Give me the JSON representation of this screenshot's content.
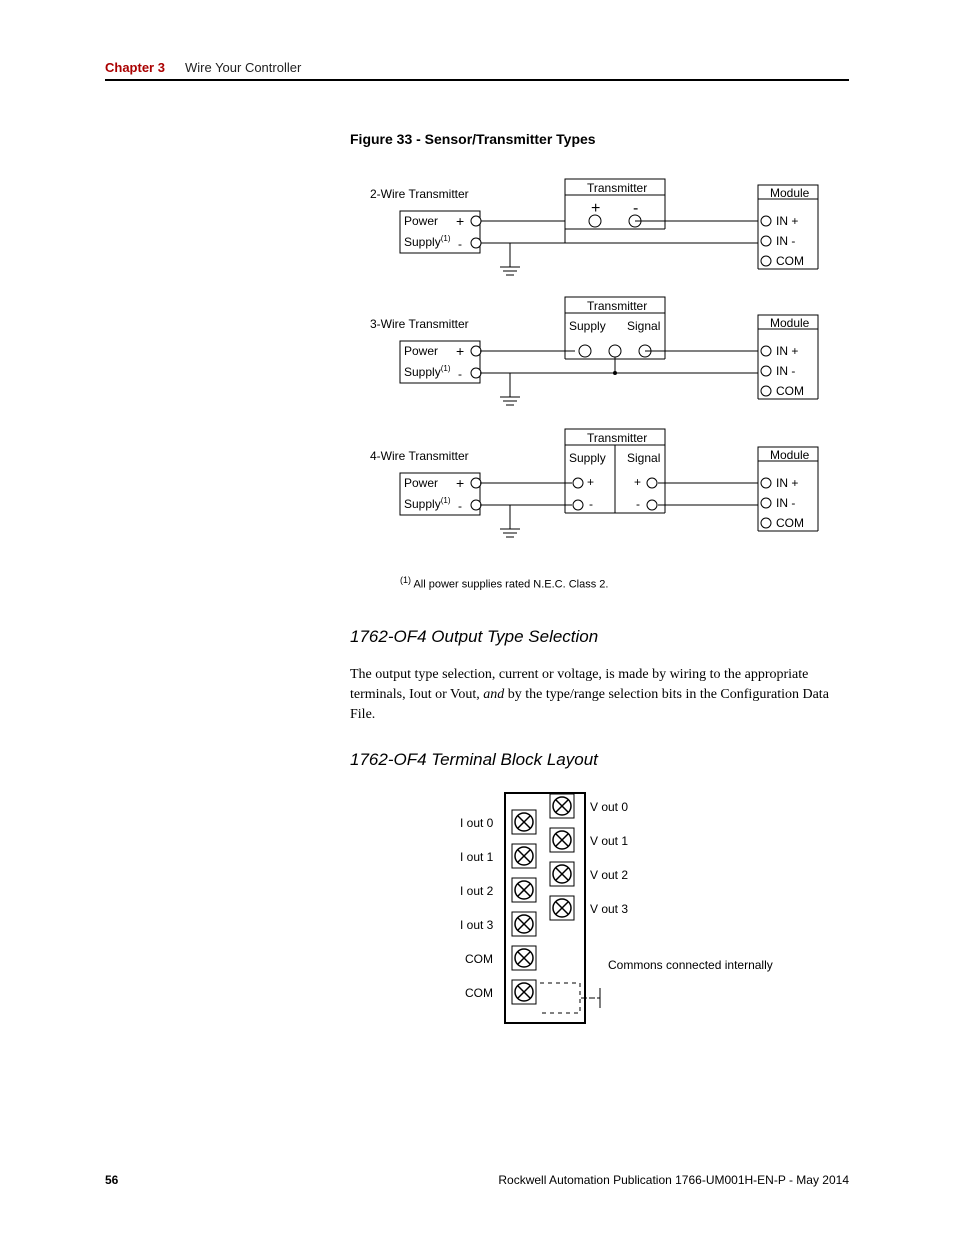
{
  "header": {
    "chapter_label": "Chapter 3",
    "chapter_title": "Wire Your Controller"
  },
  "figure33": {
    "caption": "Figure 33 - Sensor/Transmitter Types",
    "transmitters": {
      "two_wire": {
        "title": "2-Wire Transmitter",
        "tx_label": "Transmitter",
        "tx_plus": "+",
        "tx_minus": "-"
      },
      "three_wire": {
        "title": "3-Wire Transmitter",
        "tx_label": "Transmitter",
        "supply": "Supply",
        "signal": "Signal"
      },
      "four_wire": {
        "title": "4-Wire Transmitter",
        "tx_label": "Transmitter",
        "supply": "Supply",
        "signal": "Signal",
        "plus": "+",
        "minus": "-"
      }
    },
    "power": {
      "label1": "Power",
      "label2": "Supply",
      "super": "(1)",
      "plus": "+",
      "minus": "-"
    },
    "module": {
      "title": "Module",
      "in_plus": "IN +",
      "in_minus": "IN -",
      "com": "COM"
    },
    "footnote_super": "(1)",
    "footnote": " All power supplies rated N.E.C. Class 2."
  },
  "section_output": {
    "title": "1762-OF4 Output Type Selection",
    "body_a": "The output type selection, current or voltage, is made by wiring to the appropriate terminals, Iout or Vout, ",
    "body_em": "and",
    "body_b": " by the type/range selection bits in the Configuration Data File."
  },
  "section_tb": {
    "title": "1762-OF4 Terminal Block Layout",
    "left_labels": [
      "I out 0",
      "I out 1",
      "I out 2",
      "I out 3",
      "COM",
      "COM"
    ],
    "right_labels": [
      "V out 0",
      "V out 1",
      "V out 2",
      "V out 3"
    ],
    "note": "Commons connected internally"
  },
  "footer": {
    "page": "56",
    "pub": "Rockwell Automation Publication 1766-UM001H-EN-P - May 2014"
  }
}
